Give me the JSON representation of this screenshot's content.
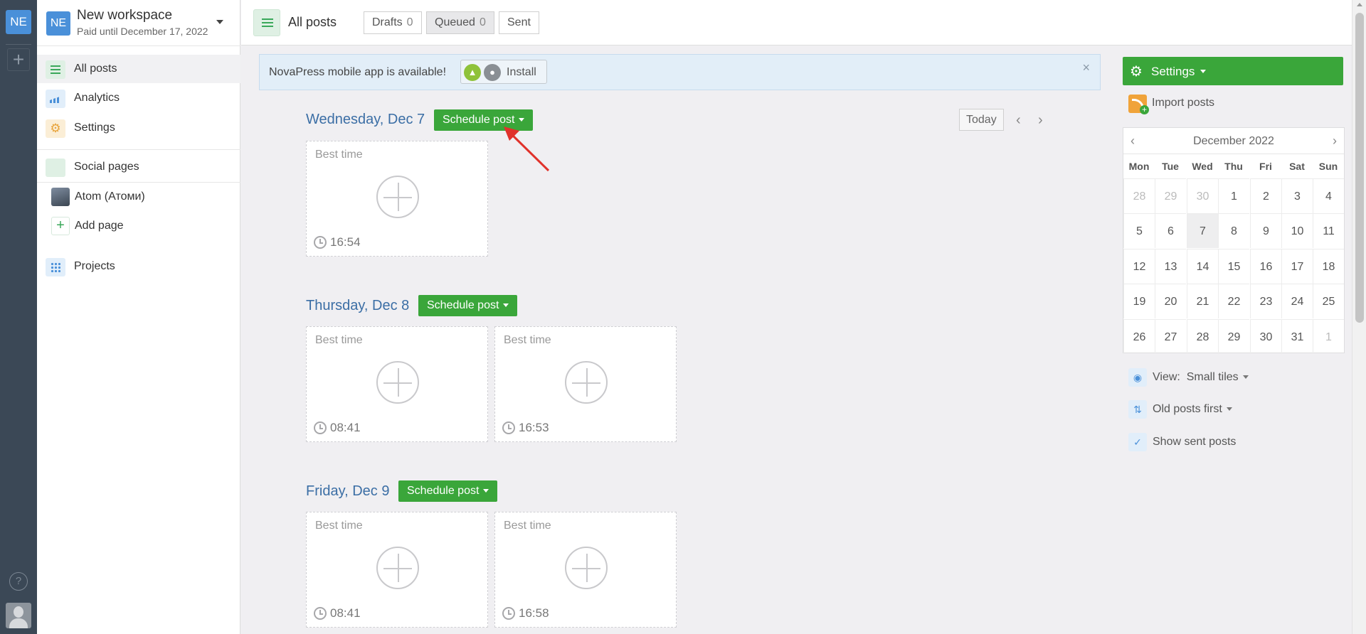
{
  "rail": {
    "workspace_badge": "NE",
    "add_label": "+",
    "help_label": "?"
  },
  "workspace": {
    "badge": "NE",
    "name": "New workspace",
    "paid_until": "Paid until December 17, 2022"
  },
  "sidebar": {
    "all_posts": "All posts",
    "analytics": "Analytics",
    "settings": "Settings",
    "social_pages": "Social pages",
    "page_atom": "Atom (Атоми)",
    "add_page": "Add page",
    "projects": "Projects"
  },
  "topbar": {
    "title": "All posts",
    "filters": [
      {
        "label": "Drafts",
        "count": "0"
      },
      {
        "label": "Queued",
        "count": "0"
      },
      {
        "label": "Sent",
        "count": ""
      }
    ]
  },
  "banner": {
    "message": "NovaPress mobile app is available!",
    "install": "Install",
    "close": "×"
  },
  "days": [
    {
      "title": "Wednesday, Dec 7",
      "button": "Schedule post",
      "tiles": [
        {
          "best": "Best time",
          "time": "16:54"
        }
      ]
    },
    {
      "title": "Thursday, Dec 8",
      "button": "Schedule post",
      "tiles": [
        {
          "best": "Best time",
          "time": "08:41"
        },
        {
          "best": "Best time",
          "time": "16:53"
        }
      ]
    },
    {
      "title": "Friday, Dec 9",
      "button": "Schedule post",
      "tiles": [
        {
          "best": "Best time",
          "time": "08:41"
        },
        {
          "best": "Best time",
          "time": "16:58"
        }
      ]
    }
  ],
  "date_nav": {
    "today": "Today",
    "prev": "‹",
    "next": "›"
  },
  "right": {
    "settings": "Settings",
    "gear": "⚙",
    "import": "Import posts",
    "calendar": {
      "month": "December 2022",
      "prev": "‹",
      "next": "›",
      "weekdays": [
        "Mon",
        "Tue",
        "Wed",
        "Thu",
        "Fri",
        "Sat",
        "Sun"
      ],
      "weeks": [
        [
          "28",
          "29",
          "30",
          "1",
          "2",
          "3",
          "4"
        ],
        [
          "5",
          "6",
          "7",
          "8",
          "9",
          "10",
          "11"
        ],
        [
          "12",
          "13",
          "14",
          "15",
          "16",
          "17",
          "18"
        ],
        [
          "19",
          "20",
          "21",
          "22",
          "23",
          "24",
          "25"
        ],
        [
          "26",
          "27",
          "28",
          "29",
          "30",
          "31",
          "1"
        ]
      ]
    },
    "view_label": "View:",
    "view_value": "Small tiles",
    "sort": "Old posts first",
    "show_sent": "Show sent posts"
  },
  "colors": {
    "accent_green": "#3aa63a",
    "link_blue": "#3b6ea5",
    "rail": "#3b4856",
    "annotation_arrow": "#e0322b"
  }
}
